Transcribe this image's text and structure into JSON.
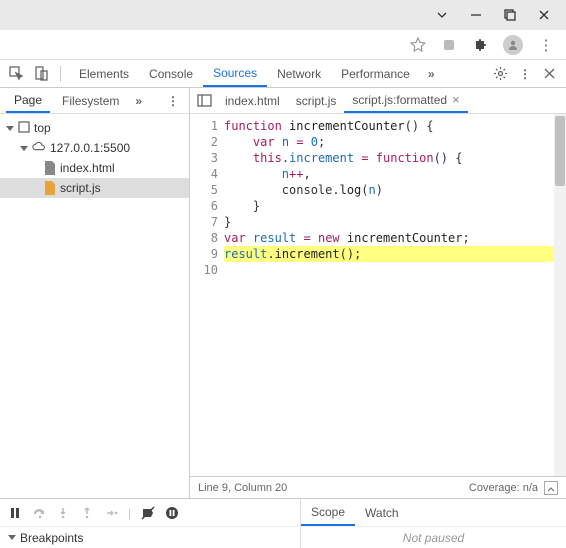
{
  "devtools": {
    "tabs": [
      "Elements",
      "Console",
      "Sources",
      "Network",
      "Performance"
    ],
    "selected_tab": "Sources"
  },
  "nav": {
    "tabs": [
      "Page",
      "Filesystem"
    ],
    "selected": "Page",
    "tree": {
      "top": "top",
      "origin": "127.0.0.1:5500",
      "files": [
        "index.html",
        "script.js"
      ],
      "selected_file": "script.js"
    }
  },
  "editor": {
    "tabs": [
      {
        "label": "index.html",
        "closable": false
      },
      {
        "label": "script.js",
        "closable": false
      },
      {
        "label": "script.js:formatted",
        "closable": true
      }
    ],
    "selected_tab": 2,
    "lines": [
      {
        "n": 1,
        "html": "<span class='tk-kw'>function</span> <span class='tk-fn'>incrementCounter</span>() {"
      },
      {
        "n": 2,
        "html": "    <span class='tk-kw'>var</span> <span class='tk-var'>n</span> <span class='tk-op'>=</span> <span class='tk-num'>0</span>;"
      },
      {
        "n": 3,
        "html": "    <span class='tk-kw'>this</span>.<span class='tk-var'>increment</span> <span class='tk-op'>=</span> <span class='tk-kw'>function</span>() {"
      },
      {
        "n": 4,
        "html": "        <span class='tk-var'>n</span><span class='tk-op'>++</span>,"
      },
      {
        "n": 5,
        "html": "        console.<span class='tk-fn'>log</span>(<span class='tk-var'>n</span>)"
      },
      {
        "n": 6,
        "html": "    }"
      },
      {
        "n": 7,
        "html": "}"
      },
      {
        "n": 8,
        "html": "<span class='tk-kw'>var</span> <span class='tk-var'>result</span> <span class='tk-op'>=</span> <span class='tk-kw'>new</span> <span class='tk-fn'>incrementCounter</span>;"
      },
      {
        "n": 9,
        "html": "<span class='tk-var'>result</span>.<span class='tk-fn'>increment</span>();",
        "hl": true
      },
      {
        "n": 10,
        "html": ""
      }
    ],
    "status": {
      "cursor": "Line 9, Column 20",
      "coverage": "Coverage: n/a"
    }
  },
  "debugger": {
    "right_tabs": [
      "Scope",
      "Watch"
    ],
    "selected_right": "Scope",
    "breakpoints_label": "Breakpoints",
    "not_paused": "Not paused"
  }
}
